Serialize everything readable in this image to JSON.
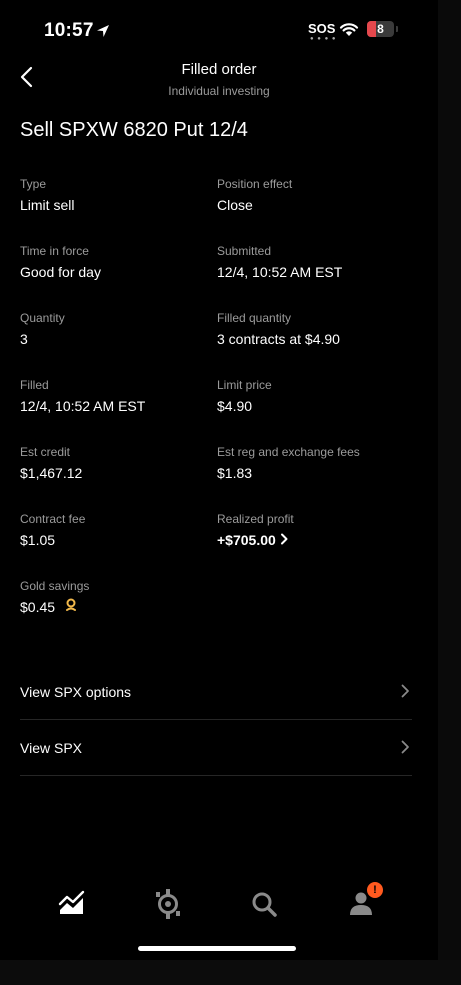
{
  "status_bar": {
    "time": "10:57",
    "sos": "SOS",
    "battery": "8"
  },
  "header": {
    "title": "Filled order",
    "subtitle": "Individual investing"
  },
  "order_title": "Sell SPXW 6820 Put 12/4",
  "fields": {
    "type": {
      "label": "Type",
      "value": "Limit sell"
    },
    "position_effect": {
      "label": "Position effect",
      "value": "Close"
    },
    "time_in_force": {
      "label": "Time in force",
      "value": "Good for day"
    },
    "submitted": {
      "label": "Submitted",
      "value": "12/4, 10:52 AM EST"
    },
    "quantity": {
      "label": "Quantity",
      "value": "3"
    },
    "filled_quantity": {
      "label": "Filled quantity",
      "value": "3 contracts at $4.90"
    },
    "filled": {
      "label": "Filled",
      "value": "12/4, 10:52 AM EST"
    },
    "limit_price": {
      "label": "Limit price",
      "value": "$4.90"
    },
    "est_credit": {
      "label": "Est credit",
      "value": "$1,467.12"
    },
    "est_fees": {
      "label": "Est reg and exchange fees",
      "value": "$1.83"
    },
    "contract_fee": {
      "label": "Contract fee",
      "value": "$1.05"
    },
    "realized_profit": {
      "label": "Realized profit",
      "value": "+$705.00"
    },
    "gold_savings": {
      "label": "Gold savings",
      "value": "$0.45"
    }
  },
  "links": [
    {
      "label": "View SPX options"
    },
    {
      "label": "View SPX"
    }
  ],
  "tab_bar": {
    "items": [
      "investing-chart-icon",
      "crypto-icon",
      "search-icon",
      "account-icon"
    ],
    "notification_badge": "!"
  },
  "colors": {
    "background": "#000000",
    "secondary_text": "#9b9b9b",
    "battery_red": "#e5484d",
    "badge": "#ff5a1f",
    "gold": "#f2b94b"
  }
}
